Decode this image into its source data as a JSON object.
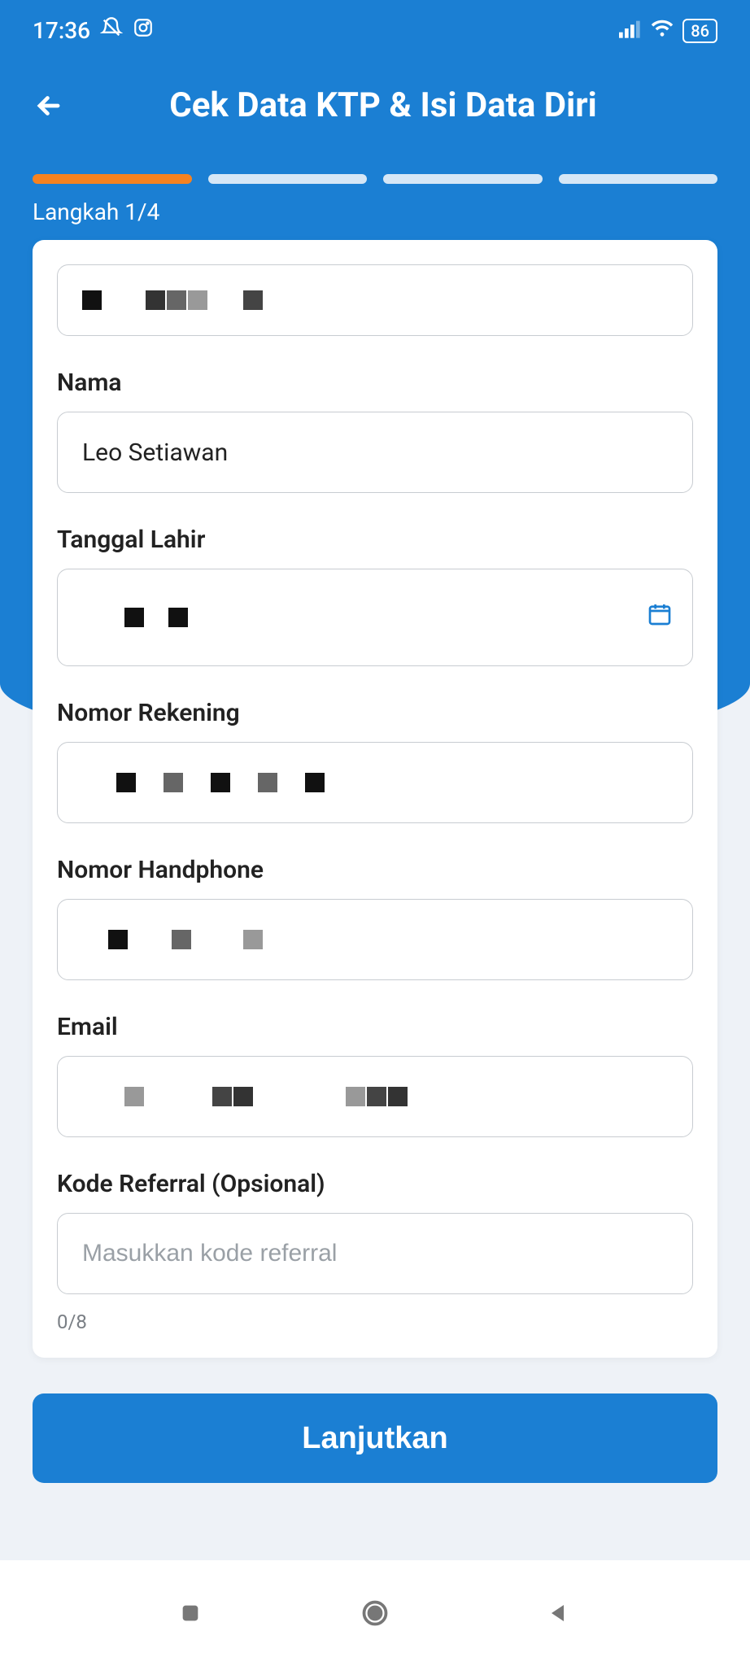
{
  "statusbar": {
    "time": "17:36",
    "battery": "86"
  },
  "header": {
    "title": "Cek Data KTP & Isi Data Diri"
  },
  "progress": {
    "step_label": "Langkah 1/4"
  },
  "form": {
    "nama_label": "Nama",
    "nama_value": "Leo Setiawan",
    "tgl_label": "Tanggal Lahir",
    "rek_label": "Nomor Rekening",
    "hp_label": "Nomor Handphone",
    "email_label": "Email",
    "referral_label": "Kode Referral (Opsional)",
    "referral_placeholder": "Masukkan kode referral",
    "referral_counter": "0/8"
  },
  "cta": {
    "continue": "Lanjutkan"
  }
}
